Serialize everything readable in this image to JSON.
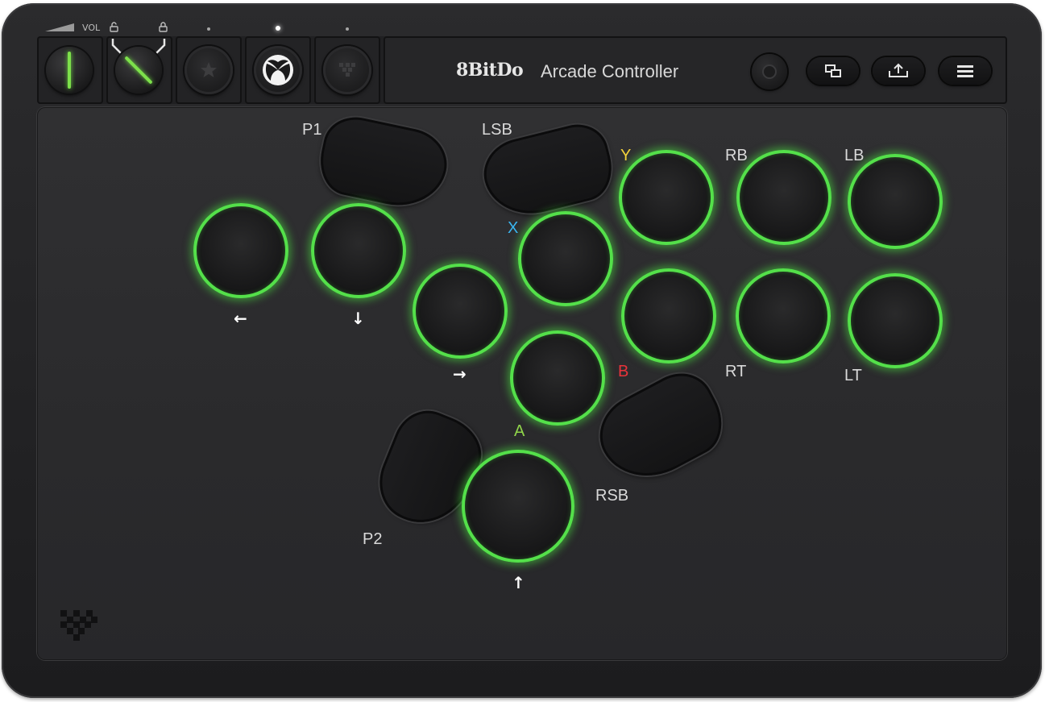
{
  "device": {
    "brand": "8BitDo",
    "model": "Arcade Controller"
  },
  "top_panel": {
    "vol_label": "VOL"
  },
  "labels": {
    "p1": "P1",
    "p2": "P2",
    "lsb": "LSB",
    "rsb": "RSB",
    "y": "Y",
    "x": "X",
    "b": "B",
    "a": "A",
    "rb": "RB",
    "lb": "LB",
    "rt": "RT",
    "lt": "LT"
  },
  "arrows": {
    "left": "←",
    "down": "↓",
    "right": "→",
    "up": "↑"
  },
  "colors": {
    "button_ring": "#54e04a",
    "y_label": "#f2d13a",
    "x_label": "#3ab6f0",
    "b_label": "#e8333a",
    "a_label": "#8fd44a",
    "body": "#2b2b2d"
  },
  "icons": {
    "xbox": "xbox-logo-icon",
    "home": "home-gear-icon",
    "view": "view-icon",
    "share": "share-icon",
    "menu": "menu-icon",
    "lock": "lock-icon",
    "unlock": "unlock-icon",
    "star": "star-icon",
    "pixel": "pixel-logo-icon"
  }
}
